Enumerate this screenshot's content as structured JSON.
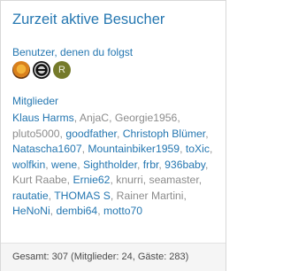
{
  "title": "Zurzeit aktive Besucher",
  "following_heading": "Benutzer, denen du folgst",
  "avatars": [
    {
      "icon": "lion-avatar-icon"
    },
    {
      "icon": "badge-avatar-icon"
    },
    {
      "letter": "R"
    }
  ],
  "members_heading": "Mitglieder",
  "members": [
    {
      "name": "Klaus Harms",
      "style": "b"
    },
    {
      "name": "AnjaC",
      "style": "g"
    },
    {
      "name": "Georgie1956",
      "style": "g"
    },
    {
      "name": "pluto5000",
      "style": "g"
    },
    {
      "name": "goodfather",
      "style": "b"
    },
    {
      "name": "Christoph Blümer",
      "style": "b"
    },
    {
      "name": "Natascha1607",
      "style": "b"
    },
    {
      "name": "Mountainbiker1959",
      "style": "b"
    },
    {
      "name": "toXic",
      "style": "b"
    },
    {
      "name": "wolfkin",
      "style": "b"
    },
    {
      "name": "wene",
      "style": "b"
    },
    {
      "name": "Sightholder",
      "style": "b"
    },
    {
      "name": "frbr",
      "style": "b"
    },
    {
      "name": "936baby",
      "style": "b"
    },
    {
      "name": "Kurt Raabe",
      "style": "g"
    },
    {
      "name": "Ernie62",
      "style": "b"
    },
    {
      "name": "knurri",
      "style": "g"
    },
    {
      "name": "seamaster",
      "style": "g"
    },
    {
      "name": "rautatie",
      "style": "b"
    },
    {
      "name": "THOMAS S",
      "style": "b"
    },
    {
      "name": "Rainer Martini",
      "style": "g"
    },
    {
      "name": "HeNoNi",
      "style": "b"
    },
    {
      "name": "dembi64",
      "style": "b"
    },
    {
      "name": "motto70",
      "style": "b"
    }
  ],
  "footer": "Gesamt: 307 (Mitglieder: 24, Gäste: 283)"
}
